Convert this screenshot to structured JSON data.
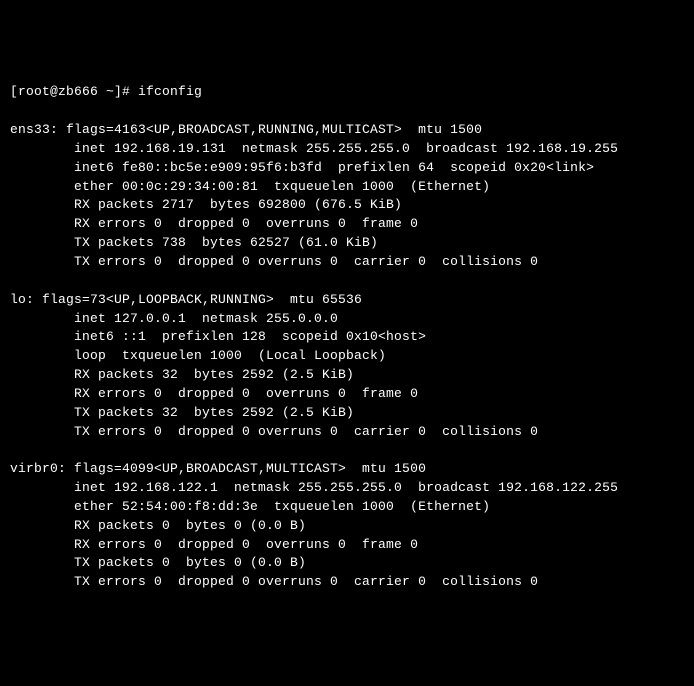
{
  "prompt": "[root@zb666 ~]# ",
  "command": "ifconfig",
  "interfaces": [
    {
      "name": "ens33",
      "header": "ens33: flags=4163<UP,BROADCAST,RUNNING,MULTICAST>  mtu 1500",
      "lines": [
        "inet 192.168.19.131  netmask 255.255.255.0  broadcast 192.168.19.255",
        "inet6 fe80::bc5e:e909:95f6:b3fd  prefixlen 64  scopeid 0x20<link>",
        "ether 00:0c:29:34:00:81  txqueuelen 1000  (Ethernet)",
        "RX packets 2717  bytes 692800 (676.5 KiB)",
        "RX errors 0  dropped 0  overruns 0  frame 0",
        "TX packets 738  bytes 62527 (61.0 KiB)",
        "TX errors 0  dropped 0 overruns 0  carrier 0  collisions 0"
      ]
    },
    {
      "name": "lo",
      "header": "lo: flags=73<UP,LOOPBACK,RUNNING>  mtu 65536",
      "lines": [
        "inet 127.0.0.1  netmask 255.0.0.0",
        "inet6 ::1  prefixlen 128  scopeid 0x10<host>",
        "loop  txqueuelen 1000  (Local Loopback)",
        "RX packets 32  bytes 2592 (2.5 KiB)",
        "RX errors 0  dropped 0  overruns 0  frame 0",
        "TX packets 32  bytes 2592 (2.5 KiB)",
        "TX errors 0  dropped 0 overruns 0  carrier 0  collisions 0"
      ]
    },
    {
      "name": "virbr0",
      "header": "virbr0: flags=4099<UP,BROADCAST,MULTICAST>  mtu 1500",
      "lines": [
        "inet 192.168.122.1  netmask 255.255.255.0  broadcast 192.168.122.255",
        "ether 52:54:00:f8:dd:3e  txqueuelen 1000  (Ethernet)",
        "RX packets 0  bytes 0 (0.0 B)",
        "RX errors 0  dropped 0  overruns 0  frame 0",
        "TX packets 0  bytes 0 (0.0 B)",
        "TX errors 0  dropped 0 overruns 0  carrier 0  collisions 0"
      ]
    }
  ]
}
